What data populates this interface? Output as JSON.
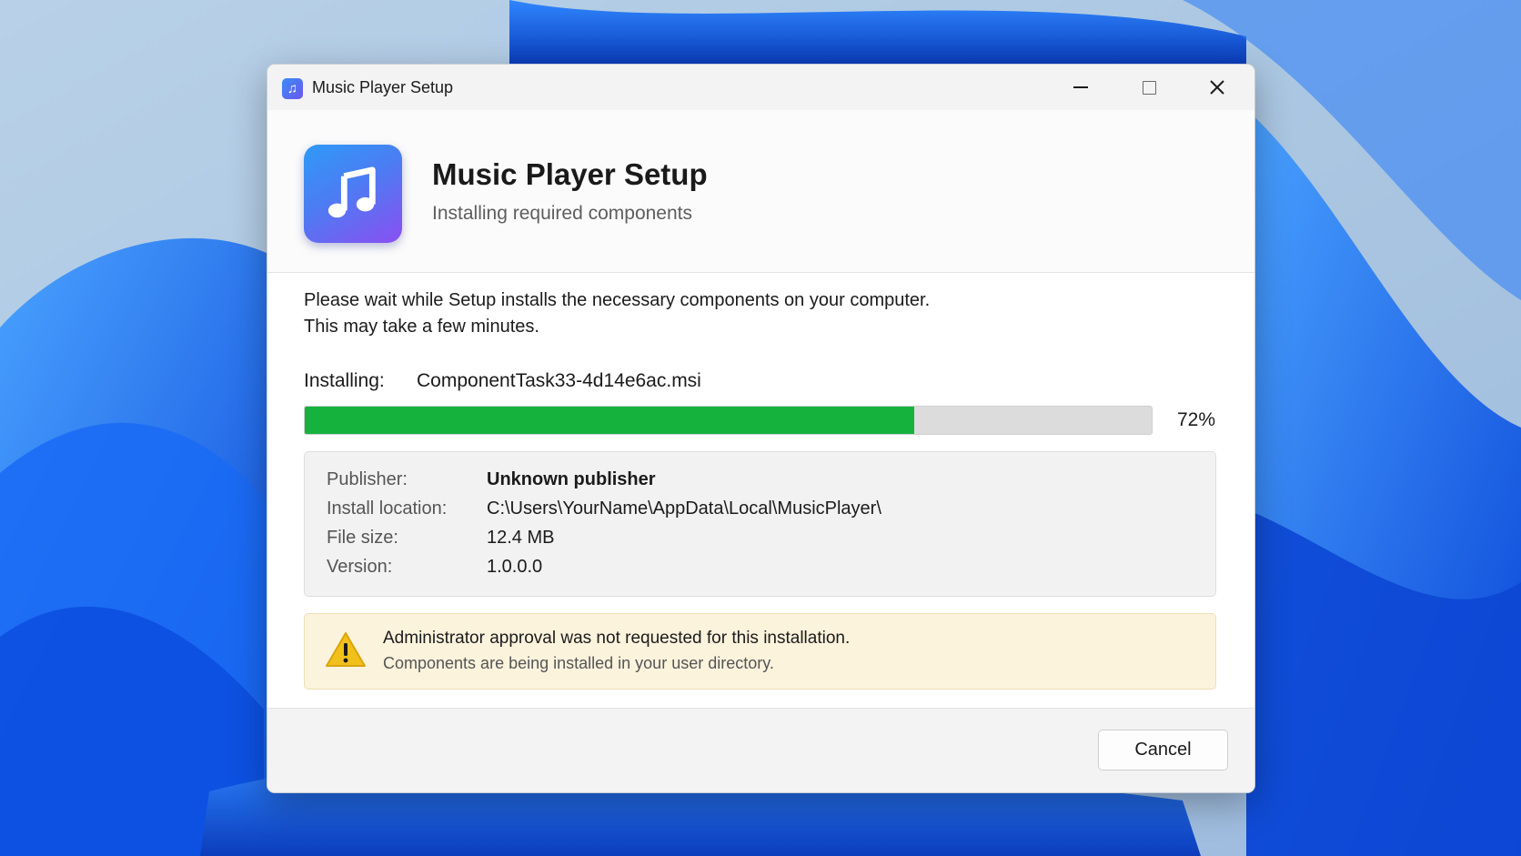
{
  "window": {
    "title": "Music Player Setup"
  },
  "header": {
    "title": "Music Player Setup",
    "subtitle": "Installing required components"
  },
  "message": {
    "line1": "Please wait while Setup installs the necessary components on your computer.",
    "line2": "This may take a few minutes."
  },
  "progress": {
    "label": "Installing:",
    "file": "ComponentTask33-4d14e6ac.msi",
    "percent": 72,
    "percent_text": "72%"
  },
  "details": [
    {
      "label": "Publisher:",
      "value": "Unknown publisher"
    },
    {
      "label": "Install location:",
      "value": "C:\\Users\\YourName\\AppData\\Local\\MusicPlayer\\"
    },
    {
      "label": "File size:",
      "value": "12.4 MB"
    },
    {
      "label": "Version:",
      "value": "1.0.0.0"
    }
  ],
  "warning": {
    "line1": "Administrator approval was not requested for this installation.",
    "line2": "Components are being installed in your user directory."
  },
  "footer": {
    "cancel_label": "Cancel"
  },
  "icons": {
    "app": "music-note-icon",
    "warning": "warning-triangle-icon",
    "minimize": "minimize-icon",
    "maximize": "maximize-icon",
    "close": "close-icon"
  },
  "colors": {
    "progress_fill": "#15b33e",
    "warning_bg": "#fcf3dd",
    "accent": "#4c7cf3"
  }
}
